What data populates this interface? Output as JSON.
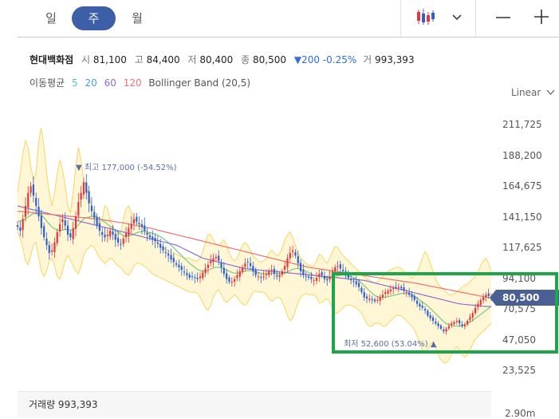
{
  "tabs": [
    {
      "label": "일",
      "active": false
    },
    {
      "label": "주",
      "active": true
    },
    {
      "label": "월",
      "active": false
    }
  ],
  "toolbar": {
    "chart_type_icon": "candlestick-icon",
    "dropdown_icon": "chevron-down-icon",
    "zoom_out_icon": "minus-icon",
    "zoom_in_icon": "plus-icon"
  },
  "stock": {
    "name": "현대백화점",
    "open_label": "시",
    "open": "81,100",
    "high_label": "고",
    "high": "84,400",
    "low_label": "저",
    "low": "80,400",
    "close_label": "종",
    "close": "80,500",
    "change": "▼200 -0.25%",
    "volume_label": "거",
    "volume": "993,393"
  },
  "indicators": {
    "ma_label": "이동평균",
    "ma": [
      {
        "period": "5",
        "color": "#4fc3c3"
      },
      {
        "period": "20",
        "color": "#3fa0dc"
      },
      {
        "period": "60",
        "color": "#8d6fd1"
      },
      {
        "period": "120",
        "color": "#e8736f"
      }
    ],
    "bollinger": "Bollinger Band (20,5)"
  },
  "scale_label": "Linear",
  "current_price_tag": "80,500",
  "annotations": {
    "high": "▼ 최고 177,000 (-54.52%)",
    "low": "최저 52,600 (53.04%) ▲"
  },
  "volume_bar": {
    "label": "거래량 993,393",
    "axis_label": "2.90m"
  },
  "colors": {
    "up": "#e8343b",
    "down": "#2d5fd3",
    "band_fill": "#fff6d6",
    "band_line": "#f7d660",
    "accent": "#3d5fa8",
    "highlight": "#1fa64a"
  },
  "chart_data": {
    "type": "candlestick",
    "title": "",
    "xlabel": "",
    "ylabel": "",
    "ylim": [
      15000,
      225000
    ],
    "y_ticks": [
      "211,725",
      "188,200",
      "164,675",
      "141,150",
      "117,625",
      "94,100",
      "70,575",
      "47,050",
      "23,525"
    ],
    "y_tick_values": [
      211725,
      188200,
      164675,
      141150,
      117625,
      94100,
      70575,
      47050,
      23525
    ],
    "close": [
      134000,
      131000,
      140000,
      150000,
      160000,
      165000,
      158000,
      150000,
      142000,
      133000,
      126000,
      120000,
      114000,
      116000,
      122000,
      130000,
      136000,
      140000,
      135000,
      128000,
      126000,
      133000,
      142000,
      153000,
      160000,
      168000,
      160000,
      152000,
      146000,
      141000,
      135000,
      131000,
      128000,
      126000,
      128000,
      131000,
      128000,
      124000,
      122000,
      121000,
      125000,
      129000,
      133000,
      136000,
      140000,
      138000,
      136000,
      134000,
      131000,
      128000,
      126000,
      124000,
      123000,
      121000,
      118000,
      116000,
      114000,
      112000,
      109000,
      107000,
      105000,
      103000,
      101000,
      99000,
      97000,
      95000,
      96000,
      95000,
      94000,
      96000,
      99000,
      102000,
      105000,
      108000,
      110000,
      111000,
      108000,
      103000,
      98000,
      94000,
      92000,
      92000,
      94000,
      97000,
      100000,
      103000,
      106000,
      107000,
      104000,
      100000,
      97000,
      96000,
      95000,
      96000,
      98000,
      100000,
      101000,
      98000,
      96000,
      97000,
      100000,
      104000,
      110000,
      114000,
      116000,
      112000,
      106000,
      100000,
      97000,
      96000,
      95000,
      94000,
      93000,
      95000,
      98000,
      97000,
      94000,
      93000,
      96000,
      100000,
      103000,
      104000,
      102000,
      100000,
      98000,
      95000,
      93000,
      92000,
      90000,
      88000,
      84000,
      80000,
      79000,
      79000,
      78000,
      77000,
      78000,
      80000,
      82000,
      84000,
      85000,
      86000,
      87000,
      88000,
      88000,
      87000,
      85000,
      84000,
      82000,
      80000,
      78000,
      75000,
      73000,
      72000,
      70000,
      66000,
      64000,
      62000,
      60000,
      58000,
      56000,
      54000,
      56000,
      58000,
      60000,
      61000,
      62000,
      60000,
      58000,
      59000,
      62000,
      65000,
      68000,
      72000,
      75000,
      78000,
      80000,
      82000,
      81000,
      80500
    ],
    "bollinger_upper": [
      160000,
      175000,
      190000,
      200000,
      195000,
      180000,
      170000,
      175000,
      200000,
      210000,
      195000,
      175000,
      160000,
      150000,
      160000,
      175000,
      185000,
      178000,
      165000,
      150000,
      145000,
      160000,
      180000,
      195000,
      185000,
      170000,
      165000,
      158000,
      150000,
      145000,
      140000,
      135000,
      140000,
      150000,
      148000,
      140000,
      135000,
      130000,
      128000,
      130000,
      140000,
      148000,
      150000,
      145000,
      140000,
      138000,
      136000,
      135000,
      132000,
      130000,
      128000,
      125000,
      124000,
      122000,
      120000,
      118000,
      117000,
      116000,
      115000,
      114000,
      113000,
      112000,
      111000,
      110000,
      110000,
      110000,
      109000,
      108000,
      108000,
      110000,
      115000,
      122000,
      128000,
      128000,
      124000,
      120000,
      120000,
      122000,
      124000,
      120000,
      114000,
      110000,
      108000,
      110000,
      115000,
      120000,
      122000,
      120000,
      116000,
      112000,
      110000,
      108000,
      107000,
      108000,
      110000,
      114000,
      116000,
      114000,
      112000,
      113000,
      118000,
      124000,
      128000,
      130000,
      126000,
      120000,
      114000,
      110000,
      108000,
      106000,
      105000,
      104000,
      104000,
      108000,
      113000,
      112000,
      108000,
      106000,
      110000,
      115000,
      119000,
      118000,
      115000,
      112000,
      110000,
      108000,
      106000,
      104000,
      102000,
      100000,
      98000,
      96000,
      94000,
      93000,
      92000,
      91000,
      92000,
      94000,
      96000,
      98000,
      100000,
      101000,
      102000,
      103000,
      103000,
      102000,
      100000,
      98000,
      96000,
      95000,
      96000,
      100000,
      104000,
      110000,
      115000,
      112000,
      106000,
      100000,
      94000,
      90000,
      88000,
      86000,
      84000,
      82000,
      82000,
      83000,
      84000,
      86000,
      88000,
      89000,
      90000,
      92000,
      94000,
      96000,
      100000,
      104000,
      108000,
      110000,
      106000,
      100000
    ],
    "bollinger_lower": [
      130000,
      125000,
      118000,
      108000,
      105000,
      112000,
      120000,
      122000,
      110000,
      100000,
      96000,
      100000,
      108000,
      110000,
      104000,
      96000,
      94000,
      100000,
      108000,
      112000,
      108000,
      104000,
      100000,
      98000,
      104000,
      112000,
      116000,
      118000,
      120000,
      118000,
      114000,
      110000,
      108000,
      106000,
      108000,
      110000,
      109000,
      106000,
      104000,
      103000,
      100000,
      98000,
      97000,
      100000,
      104000,
      106000,
      106000,
      105000,
      104000,
      102000,
      100000,
      98000,
      97000,
      96000,
      95000,
      94000,
      93000,
      92000,
      91000,
      90000,
      89000,
      88000,
      87000,
      86000,
      85000,
      84000,
      84000,
      84000,
      83000,
      80000,
      76000,
      72000,
      70000,
      74000,
      80000,
      84000,
      86000,
      82000,
      78000,
      76000,
      78000,
      80000,
      82000,
      80000,
      77000,
      75000,
      74000,
      76000,
      80000,
      84000,
      85000,
      84000,
      84000,
      84000,
      82000,
      79000,
      77000,
      78000,
      80000,
      80000,
      77000,
      72000,
      66000,
      62000,
      64000,
      70000,
      76000,
      80000,
      82000,
      83000,
      82000,
      82000,
      82000,
      80000,
      76000,
      76000,
      78000,
      79000,
      76000,
      72000,
      68000,
      68000,
      70000,
      72000,
      74000,
      74000,
      74000,
      73000,
      72000,
      70000,
      68000,
      64000,
      60000,
      58000,
      58000,
      60000,
      60000,
      60000,
      58000,
      58000,
      60000,
      62000,
      64000,
      66000,
      66000,
      66000,
      64000,
      62000,
      60000,
      58000,
      55000,
      50000,
      45000,
      40000,
      38000,
      40000,
      44000,
      46000,
      42000,
      36000,
      32000,
      30000,
      30000,
      32000,
      36000,
      40000,
      42000,
      40000,
      36000,
      34000,
      36000,
      40000,
      44000,
      48000,
      50000,
      52000,
      54000,
      56000,
      58000,
      60000
    ],
    "ma_lines": [
      {
        "period": 20,
        "values": [
          138000,
          138500,
          139000,
          140000,
          141500,
          143000,
          144000,
          144500,
          144000,
          143000,
          141000,
          138500,
          136000,
          134000,
          132500,
          131500,
          131000,
          131500,
          132000,
          132000,
          131500,
          132000,
          133500,
          135500,
          138000,
          140000,
          141000,
          141500,
          142000,
          142000,
          141500,
          140500,
          139000,
          137500,
          136000,
          134500,
          133000,
          131500,
          130000,
          128500,
          127500,
          127000,
          127000,
          127500,
          128500,
          129500,
          130000,
          130500,
          130500,
          130000,
          129500,
          129000,
          128500,
          127500,
          126500,
          125000,
          123500,
          122000,
          120000,
          118000,
          116000,
          114000,
          112000,
          110000,
          108000,
          106000,
          104500,
          103000,
          101500,
          100500,
          100000,
          100000,
          100500,
          101500,
          102500,
          103000,
          103000,
          102500,
          102000,
          101000,
          100000,
          99000,
          98500,
          98500,
          99000,
          99500,
          100000,
          100500,
          100500,
          100000,
          99500,
          99000,
          98500,
          98000,
          98000,
          98000,
          98500,
          98500,
          98000,
          98000,
          98000,
          98500,
          99500,
          100500,
          101500,
          102000,
          102000,
          101500,
          101000,
          100000,
          99000,
          98000,
          97000,
          96500,
          96500,
          96000,
          95500,
          95000,
          95000,
          95500,
          96000,
          96500,
          97000,
          97000,
          97000,
          96500,
          96000,
          95000,
          94000,
          92500,
          91000,
          89000,
          87000,
          85000,
          83000,
          81500,
          80500,
          80000,
          80000,
          80000,
          80500,
          81000,
          81500,
          82000,
          82500,
          83000,
          83000,
          83000,
          82500,
          82000,
          81000,
          79500,
          78000,
          76500,
          75000,
          73500,
          71500,
          69500,
          67500,
          65500,
          63500,
          61500,
          60000,
          59000,
          58500,
          58000,
          58000,
          58000,
          58500,
          59000,
          60000,
          61000,
          62500,
          64000,
          65500,
          67000,
          68500,
          70000,
          71500,
          73000
        ]
      },
      {
        "period": 60,
        "values": [
          150000,
          149500,
          149000,
          148500,
          148000,
          147500,
          147000,
          146500,
          146000,
          145500,
          145000,
          144500,
          144000,
          143500,
          143000,
          142500,
          142000,
          141500,
          141000,
          140500,
          140000,
          139500,
          139000,
          138500,
          138000,
          137500,
          137000,
          136500,
          136000,
          135500,
          135000,
          134500,
          134000,
          133500,
          133000,
          132500,
          132000,
          131500,
          131000,
          130500,
          130000,
          129500,
          129000,
          128500,
          128000,
          127500,
          127000,
          126500,
          126000,
          125500,
          125000,
          124500,
          124000,
          123500,
          123000,
          122500,
          122000,
          121500,
          121000,
          120500,
          120000,
          119000,
          118000,
          117000,
          116000,
          115000,
          114000,
          113000,
          112000,
          111000,
          110000,
          109500,
          109000,
          108500,
          108000,
          107500,
          107000,
          106500,
          106000,
          105500,
          105000,
          104500,
          104000,
          103500,
          103000,
          102500,
          102000,
          101800,
          101600,
          101400,
          101200,
          101000,
          100800,
          100600,
          100400,
          100200,
          100000,
          99800,
          99600,
          99400,
          99200,
          99000,
          98800,
          98600,
          98400,
          98200,
          98000,
          97800,
          97600,
          97400,
          97200,
          97000,
          96800,
          96600,
          96400,
          96200,
          96000,
          95800,
          95600,
          95400,
          95200,
          95000,
          94800,
          94600,
          94400,
          94200,
          94000,
          93800,
          93600,
          93400,
          93200,
          93000,
          92500,
          92000,
          91500,
          91000,
          90500,
          90000,
          89500,
          89000,
          88500,
          88000,
          87500,
          87000,
          86500,
          86000,
          85500,
          85000,
          84500,
          84000,
          83500,
          83000,
          82500,
          82000,
          81500,
          81000,
          80500,
          80000,
          79500,
          79000,
          78500,
          78000,
          77500,
          77000,
          76500,
          76000,
          75500,
          75000,
          74800,
          74600,
          74400,
          74200,
          74000,
          73800,
          73600,
          73400,
          73200,
          73000,
          73000,
          73000
        ]
      },
      {
        "period": 120,
        "values": [
          146000,
          145800,
          145600,
          145400,
          145200,
          145000,
          144800,
          144600,
          144400,
          144200,
          144000,
          143800,
          143600,
          143400,
          143200,
          143000,
          142800,
          142600,
          142400,
          142200,
          142000,
          141800,
          141600,
          141400,
          141200,
          141000,
          140800,
          140600,
          140400,
          140200,
          140000,
          139700,
          139400,
          139100,
          138800,
          138500,
          138200,
          137900,
          137600,
          137300,
          137000,
          136600,
          136200,
          135800,
          135400,
          135000,
          134600,
          134200,
          133800,
          133400,
          133000,
          132500,
          132000,
          131500,
          131000,
          130500,
          130000,
          129500,
          129000,
          128500,
          128000,
          127500,
          127000,
          126500,
          126000,
          125500,
          125000,
          124500,
          124000,
          123500,
          123000,
          122500,
          122000,
          121500,
          121000,
          120500,
          120000,
          119500,
          119000,
          118500,
          118000,
          117500,
          117000,
          116500,
          116000,
          115500,
          115000,
          114500,
          114000,
          113500,
          113000,
          112500,
          112000,
          111500,
          111000,
          110500,
          110000,
          109500,
          109000,
          108500,
          108000,
          107500,
          107000,
          106500,
          106000,
          105500,
          105000,
          104500,
          104000,
          103500,
          103000,
          102700,
          102400,
          102100,
          101800,
          101500,
          101200,
          100900,
          100600,
          100300,
          100000,
          99700,
          99400,
          99100,
          98800,
          98500,
          98200,
          97900,
          97600,
          97300,
          97000,
          96700,
          96400,
          96100,
          95800,
          95500,
          95200,
          94900,
          94600,
          94300,
          94000,
          93700,
          93400,
          93100,
          92800,
          92500,
          92200,
          91900,
          91600,
          91300,
          91000,
          90600,
          90200,
          89800,
          89400,
          89000,
          88600,
          88200,
          87800,
          87400,
          87000,
          86600,
          86200,
          85800,
          85400,
          85000,
          84600,
          84200,
          83800,
          83400,
          83000,
          82600,
          82200,
          81800,
          81400,
          81000,
          80600,
          80200,
          79800,
          79400,
          79000,
          78600,
          78200,
          77800
        ]
      }
    ],
    "current_price": 80500,
    "max_value": 177000,
    "min_value": 52600
  }
}
